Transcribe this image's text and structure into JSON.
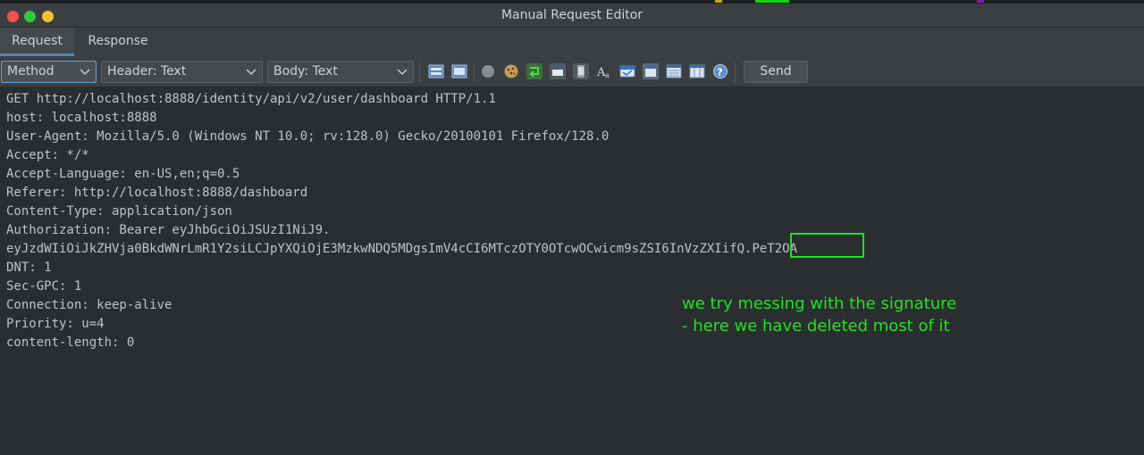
{
  "window": {
    "title": "Manual Request Editor"
  },
  "tabs": [
    {
      "label": "Request",
      "active": true
    },
    {
      "label": "Response",
      "active": false
    }
  ],
  "toolbar": {
    "method_combo": "Method",
    "header_combo": "Header: Text",
    "body_combo": "Body: Text",
    "send_label": "Send",
    "icons": [
      "layout-split-icon",
      "layout-tabs-icon",
      "circle-icon",
      "cookie-icon",
      "redirect-icon",
      "window-icon",
      "phone-icon",
      "font-icon",
      "browser-icon",
      "panel-icon",
      "list-icon",
      "table-icon",
      "help-icon"
    ]
  },
  "request_lines": [
    "GET http://localhost:8888/identity/api/v2/user/dashboard HTTP/1.1",
    "host: localhost:8888",
    "User-Agent: Mozilla/5.0 (Windows NT 10.0; rv:128.0) Gecko/20100101 Firefox/128.0",
    "Accept: */*",
    "Accept-Language: en-US,en;q=0.5",
    "Referer: http://localhost:8888/dashboard",
    "Content-Type: application/json",
    "Authorization: Bearer eyJhbGciOiJSUzI1NiJ9.",
    "eyJzdWIiOiJkZHVja0BkdWNrLmR1Y2siLCJpYXQiOjE3MzkwNDQ5MDgsImV4cCI6MTczOTY0OTcwOCwicm9sZSI6InVzZXIifQ.PeT2OA",
    "DNT: 1",
    "Sec-GPC: 1",
    "Connection: keep-alive",
    "Priority: u=4",
    "content-length: 0"
  ],
  "annotation": {
    "line1": "we try messing with the signature",
    "line2": "- here we have deleted most of it"
  },
  "colors": {
    "annotation": "#22e022",
    "accent": "#4a88c7"
  }
}
